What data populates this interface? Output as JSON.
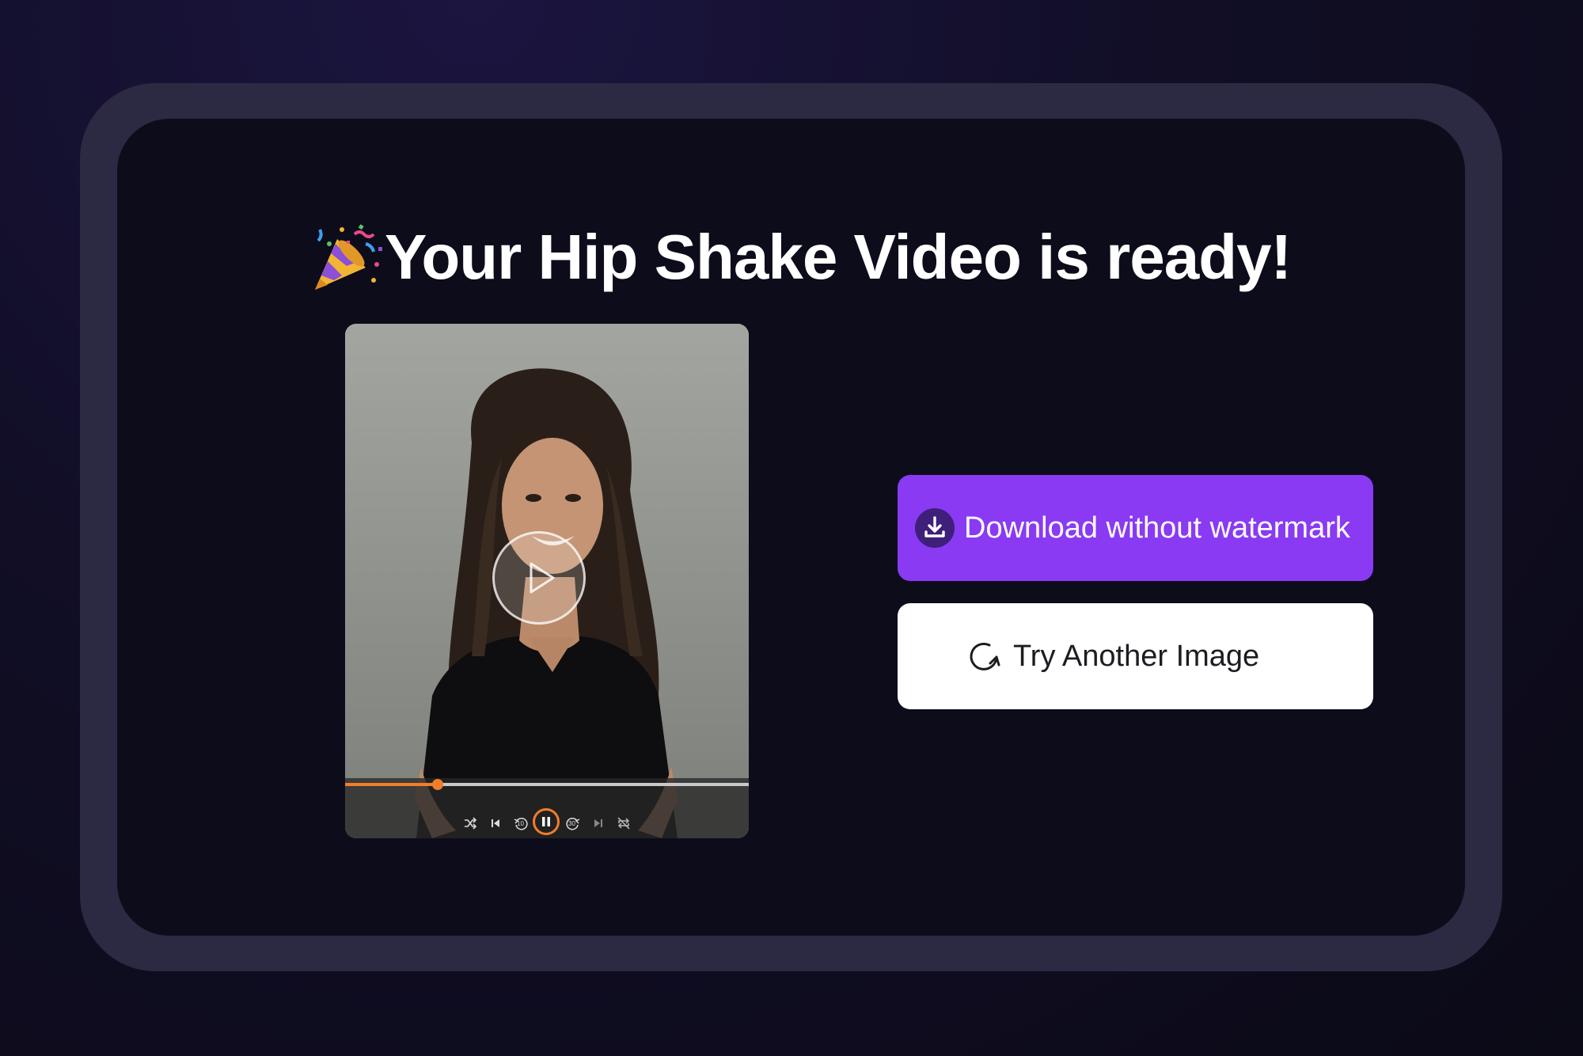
{
  "headline": {
    "text": "Your Hip Shake Video is ready!",
    "icon": "party-popper-icon"
  },
  "video": {
    "progress_percent": 23,
    "controls": [
      "shuffle-icon",
      "skip-back-icon",
      "rewind-10-icon",
      "pause-icon",
      "forward-30-icon",
      "skip-forward-icon",
      "repeat-off-icon"
    ],
    "rewind_label": "10",
    "forward_label": "30"
  },
  "actions": {
    "download_label": "Download without watermark",
    "download_icon": "download-icon",
    "try_again_label": "Try Another Image",
    "try_again_icon": "refresh-icon"
  },
  "colors": {
    "accent_purple": "#8a3af3",
    "progress_orange": "#f27d2a",
    "panel_bg": "#0d0c1b",
    "frame_bg": "#2c2a42"
  }
}
